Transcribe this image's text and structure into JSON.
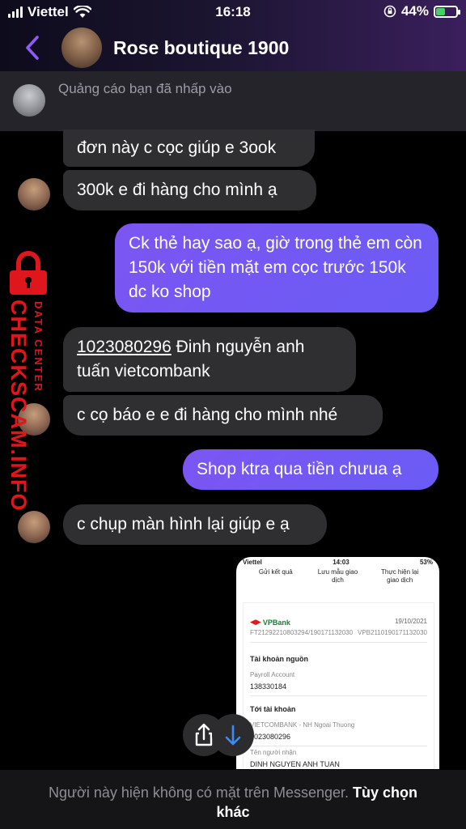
{
  "status_bar": {
    "carrier": "Viettel",
    "time": "16:18",
    "battery_percent": "44%",
    "battery_level": 0.44,
    "colors": {
      "battery_fill": "#46d160"
    }
  },
  "header": {
    "title": "Rose boutique 1900",
    "back_icon": "chevron-left-icon"
  },
  "ad_notice": {
    "text": "Quảng cáo bạn đã nhấp vào"
  },
  "messages": [
    {
      "direction": "incoming",
      "text": "đơn này c cọc giúp e 3ook"
    },
    {
      "direction": "incoming",
      "text": "300k e đi hàng cho mình ạ"
    },
    {
      "direction": "outgoing",
      "text": "Ck thẻ hay sao ạ, giờ trong thẻ em còn 150k với tiền mặt em cọc trước 150k dc ko shop"
    },
    {
      "direction": "incoming",
      "account": "1023080296",
      "text": " Đinh nguyễn anh tuấn vietcombank"
    },
    {
      "direction": "incoming",
      "text": "c cọ báo e e đi hàng cho mình nhé"
    },
    {
      "direction": "outgoing",
      "text": "Shop ktra qua tiền chưua ạ"
    },
    {
      "direction": "incoming",
      "text": "c chụp màn hình lại giúp e ạ"
    }
  ],
  "watermark": {
    "big": "CHECKSCAM.INFO",
    "small": "DATA CENTER",
    "color": "#e0161d"
  },
  "shared_image": {
    "carrier": "Viettel",
    "time": "14:03",
    "battery": "53%",
    "tabs": [
      "Gửi kết quả",
      "Lưu mẫu giao dịch",
      "Thực hiện lại giao dịch"
    ],
    "bank": "VPBank",
    "date": "19/10/2021",
    "ref_left": "FT21292210803294/190171132030",
    "ref_right": "VPB2110190171132030",
    "source_title": "Tài khoản nguồn",
    "source_label": "Payroll Account",
    "source_value": "138330184",
    "dest_title": "Tới tài khoản",
    "dest_bank": "VIETCOMBANK - NH Ngoai Thuong",
    "dest_value": "1023080296",
    "recipient_label": "Tên người nhận",
    "recipient_value": "DINH NGUYEN ANH TUAN"
  },
  "floating_buttons": {
    "share_icon": "share-icon",
    "scroll_down_icon": "arrow-down-icon"
  },
  "bottom_bar": {
    "text": "Người này hiện không có mặt trên Messenger.",
    "action": "Tùy chọn khác"
  },
  "colors": {
    "outgoing_bubble": "#7c55f2",
    "incoming_bubble": "#2f2f31",
    "accent": "#8e5cf5"
  }
}
